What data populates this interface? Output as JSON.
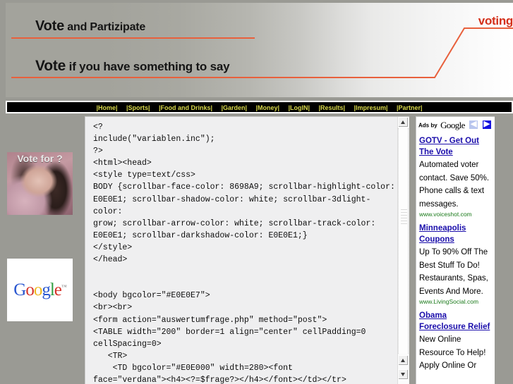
{
  "banner": {
    "line1_strong": "Vote",
    "line1_rest": " and Partizipate",
    "line2_strong": "Vote",
    "line2_rest": " if you have something to say",
    "brand_word": "voting",
    "accent_color": "#e8603c",
    "brand_color": "#d4301a"
  },
  "nav": {
    "items": [
      {
        "label": "|Home|"
      },
      {
        "label": "|Sports|"
      },
      {
        "label": "|Food and Drinks|"
      },
      {
        "label": "|Garden|"
      },
      {
        "label": "|Money|"
      },
      {
        "label": "|LogIN|"
      },
      {
        "label": "|Results|"
      },
      {
        "label": "|Impresum|"
      },
      {
        "label": "|Partner|"
      }
    ],
    "link_color": "#d8d84a",
    "bg_color": "#000000"
  },
  "left": {
    "vote_image_caption": "Vote for ?",
    "google_logo": {
      "g1": "G",
      "o1": "o",
      "o2": "o",
      "g2": "g",
      "l": "l",
      "e": "e",
      "tm": "™"
    }
  },
  "code": {
    "text": "<?\ninclude(\"variablen.inc\");\n?>\n<html><head>\n<style type=text/css>\nBODY {scrollbar-face-color: 8698A9; scrollbar-highlight-color: E0E0E1; scrollbar-shadow-color: white; scrollbar-3dlight-color:\ngrow; scrollbar-arrow-color: white; scrollbar-track-color: E0E0E1; scrollbar-darkshadow-color: E0E0E1;}\n</style>\n</head>\n\n\n<body bgcolor=\"#E0E0E7\">\n<br><br>\n<form action=\"auswertumfrage.php\" method=\"post\">\n<TABLE width=\"200\" border=1 align=\"center\" cellPadding=0 cellSpacing=0>\n   <TR>\n    <TD bgcolor=\"#E0E000\" width=280><font\nface=\"verdana\"><h4><?=$frage?></h4></font></td></tr>"
  },
  "ads": {
    "ads_by_label": "Ads by",
    "google_label": "Google",
    "prev_glyph": "◀",
    "next_glyph": "▶",
    "items": [
      {
        "title": "GOTV - Get Out The Vote",
        "desc": "Automated voter contact. Save 50%. Phone calls & text messages.",
        "url": "www.voiceshot.com"
      },
      {
        "title": "Minneapolis Coupons",
        "desc": "Up To 90% Off The Best Stuff To Do! Restaurants, Spas, Events And More.",
        "url": "www.LivingSocial.com"
      },
      {
        "title": "Obama Foreclosure Relief",
        "desc": "New Online Resource To Help! Apply Online Or",
        "url": ""
      }
    ]
  }
}
